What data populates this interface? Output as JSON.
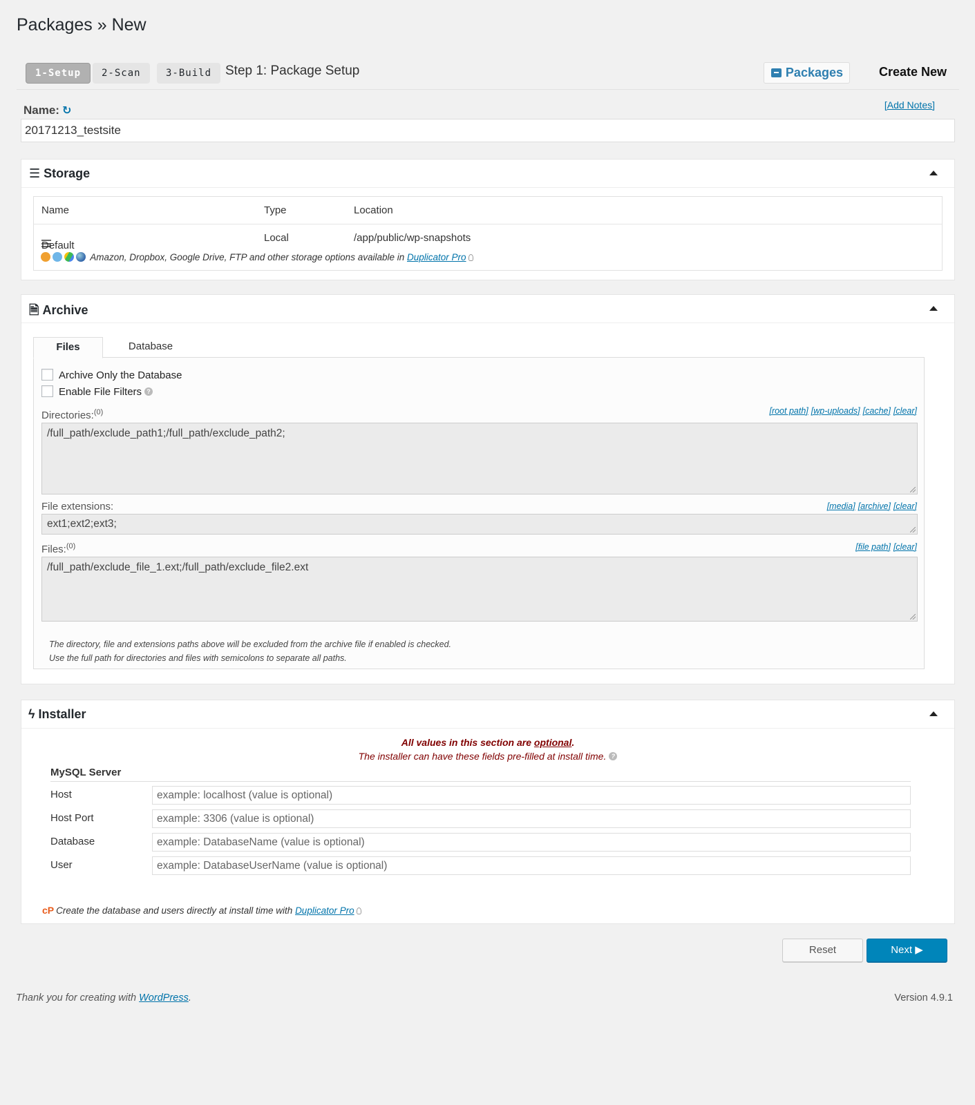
{
  "page": {
    "title": "Packages » New"
  },
  "steps": {
    "items": [
      {
        "label": "1-Setup"
      },
      {
        "label": "2-Scan"
      },
      {
        "label": "3-Build"
      }
    ],
    "current_title": "Step 1: Package Setup",
    "packages_label": "Packages",
    "create_new_label": "Create New"
  },
  "name": {
    "label": "Name:",
    "value": "20171213_testsite",
    "add_notes": "[Add Notes]"
  },
  "storage": {
    "title": "Storage",
    "columns": [
      "Name",
      "Type",
      "Location"
    ],
    "rows": [
      {
        "name": "Default",
        "type": "Local",
        "location": "/app/public/wp-snapshots"
      }
    ],
    "pro_text": "Amazon, Dropbox, Google Drive, FTP and other storage options available in ",
    "pro_link": "Duplicator Pro"
  },
  "archive": {
    "title": "Archive",
    "tabs": [
      "Files",
      "Database"
    ],
    "checkboxes": [
      {
        "label": "Archive Only the Database",
        "checked": false
      },
      {
        "label": "Enable File Filters",
        "checked": false
      }
    ],
    "directories": {
      "label": "Directories:",
      "count": "(0)",
      "links": [
        "[root path]",
        "[wp-uploads]",
        "[cache]",
        "[clear]"
      ],
      "value": "/full_path/exclude_path1;/full_path/exclude_path2;"
    },
    "extensions": {
      "label": "File extensions:",
      "links": [
        "[media]",
        "[archive]",
        "[clear]"
      ],
      "value": "ext1;ext2;ext3;"
    },
    "files": {
      "label": "Files:",
      "count": "(0)",
      "links": [
        "[file path]",
        "[clear]"
      ],
      "value": "/full_path/exclude_file_1.ext;/full_path/exclude_file2.ext"
    },
    "note_line1": "The directory, file and extensions paths above will be excluded from the archive file if enabled is checked.",
    "note_line2": "Use the full path for directories and files with semicolons to separate all paths."
  },
  "installer": {
    "title": "Installer",
    "msg1_prefix": "All values in this section are ",
    "msg1_link": "optional",
    "msg1_suffix": ".",
    "msg2": "The installer can have these fields pre-filled at install time.",
    "section_label": "MySQL Server",
    "fields": [
      {
        "label": "Host",
        "placeholder": "example: localhost (value is optional)"
      },
      {
        "label": "Host Port",
        "placeholder": "example: 3306 (value is optional)"
      },
      {
        "label": "Database",
        "placeholder": "example: DatabaseName (value is optional)"
      },
      {
        "label": "User",
        "placeholder": "example: DatabaseUserName (value is optional)"
      }
    ],
    "pro_text": "Create the database and users directly at install time with ",
    "pro_link": "Duplicator Pro"
  },
  "actions": {
    "reset": "Reset",
    "next": "Next ▶"
  },
  "footer": {
    "thanks_prefix": "Thank you for creating with ",
    "thanks_link": "WordPress",
    "thanks_suffix": ".",
    "version": "Version 4.9.1"
  },
  "colors": {
    "accent": "#0073aa",
    "primary_button": "#0085ba",
    "notice_text": "#800000"
  }
}
